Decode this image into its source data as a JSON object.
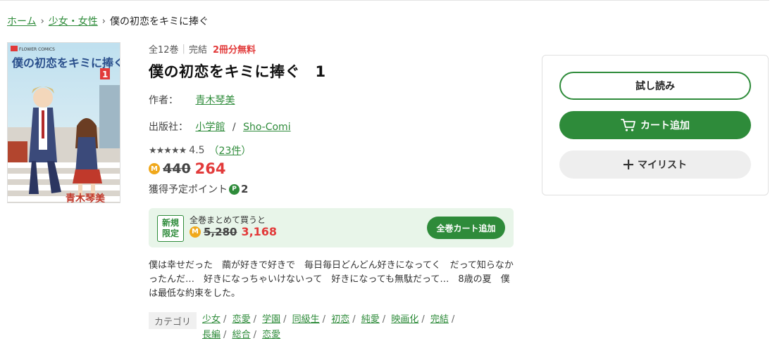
{
  "breadcrumb": {
    "home": "ホーム",
    "category": "少女・女性",
    "current": "僕の初恋をキミに捧ぐ"
  },
  "cover": {
    "publisher_mark": "FLOWER COMICS",
    "title_text": "僕の初恋をキミに捧ぐ",
    "volume": "1",
    "author_text": "青木琴美"
  },
  "meta": {
    "volumes": "全12巻",
    "status": "完結",
    "free": "2冊分無料"
  },
  "title": "僕の初恋をキミに捧ぐ　1",
  "author": {
    "label": "作者：",
    "name": "青木琴美"
  },
  "publisher": {
    "label": "出版社：",
    "name": "小学館",
    "label2": "Sho-Comi"
  },
  "rating": {
    "stars": "★★★★★",
    "value": "4.5",
    "count": "23件",
    "open": "（",
    "close": "）"
  },
  "price": {
    "coin": "M",
    "original": "440",
    "sale": "264"
  },
  "points": {
    "label": "獲得予定ポイント",
    "badge": "P",
    "value": "2"
  },
  "bundle": {
    "badge_line1": "新規",
    "badge_line2": "限定",
    "label": "全巻まとめて買うと",
    "original": "5,280",
    "sale": "3,168",
    "button": "全巻カート追加"
  },
  "description": "僕は幸せだった　繭が好きで好きで　毎日毎日どんどん好きになってく　だって知らなかったんだ…　好きになっちゃいけないって　好きになっても無駄だって…　8歳の夏　僕は最低な約束をした。",
  "categories": {
    "label": "カテゴリ",
    "items": [
      "少女",
      "恋愛",
      "学園",
      "同級生",
      "初恋",
      "純愛",
      "映画化",
      "完結",
      "長編",
      "総合",
      "恋愛"
    ]
  },
  "actions": {
    "try": "試し読み",
    "cart": "カート追加",
    "mylist": "マイリスト"
  },
  "colors": {
    "accent": "#2e8b3a",
    "sale_red": "#e23a3a",
    "bundle_bg": "#e8f5e9",
    "coin": "#f0a81b"
  }
}
